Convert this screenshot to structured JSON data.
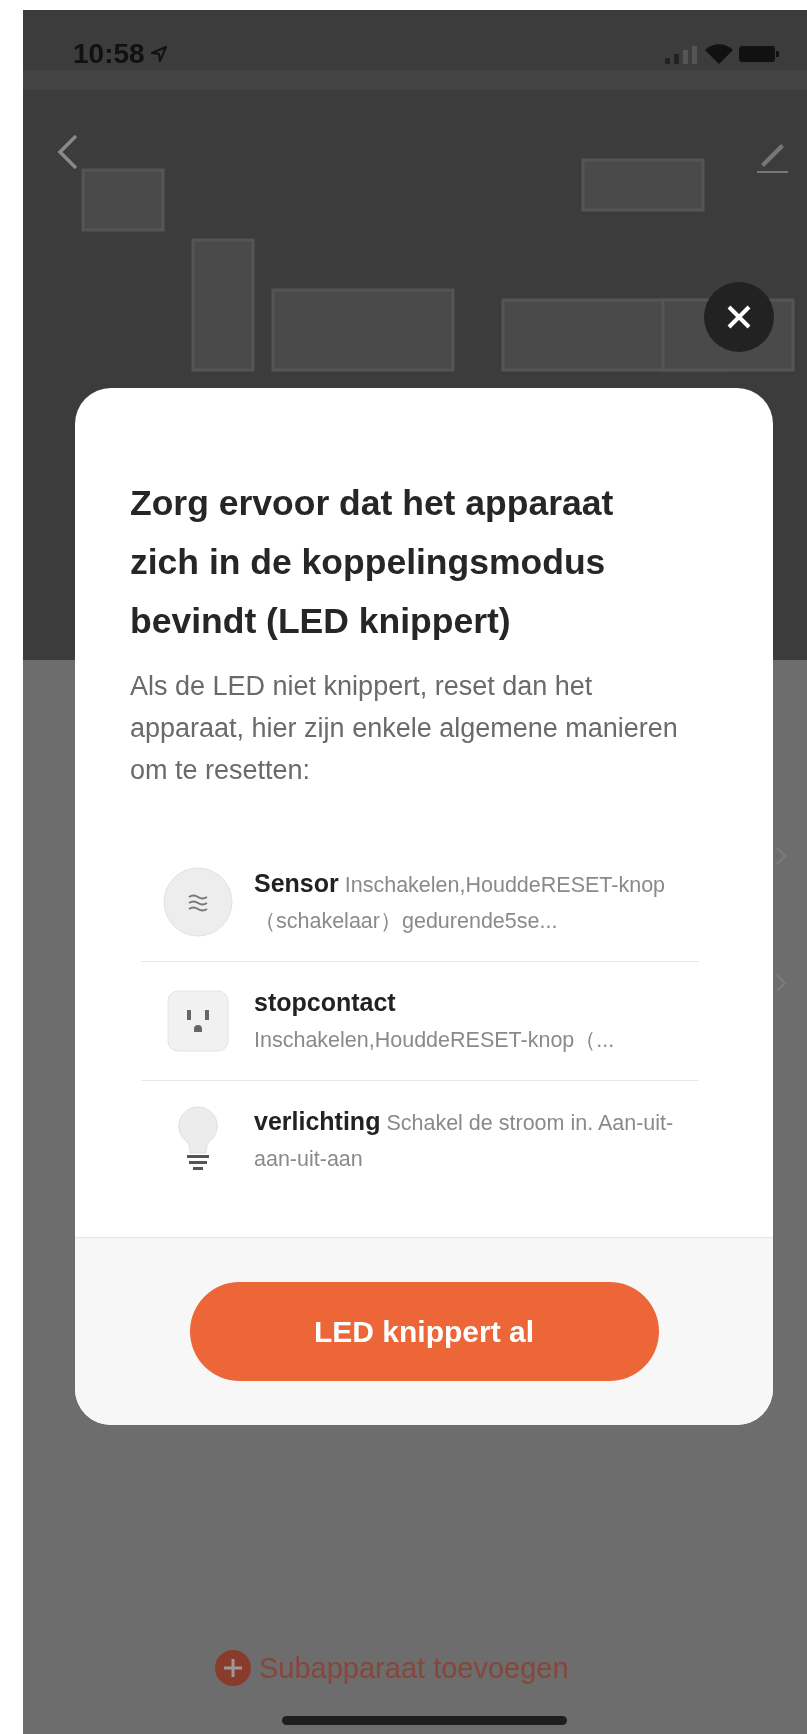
{
  "status_bar": {
    "time": "10:58"
  },
  "dialog": {
    "title": "Zorg ervoor dat het apparaat zich in de koppelingsmodus bevindt (LED knippert)",
    "description": "Als de LED niet knippert, reset dan het apparaat, hier zijn enkele algemene manieren om te resetten:",
    "methods": [
      {
        "kind": "sensor",
        "name": "Sensor",
        "text": "Inschakelen,HouddeRESET-knop（schakelaar）gedurende5se..."
      },
      {
        "kind": "socket",
        "name": "stopcontact",
        "text": "Inschakelen,HouddeRESET-knop（..."
      },
      {
        "kind": "light",
        "name": "verlichting",
        "text": "Schakel de stroom in. Aan-uit-aan-uit-aan"
      }
    ],
    "button": "LED knippert al"
  },
  "add_subdevice": {
    "label": "Subapparaat toevoegen"
  }
}
